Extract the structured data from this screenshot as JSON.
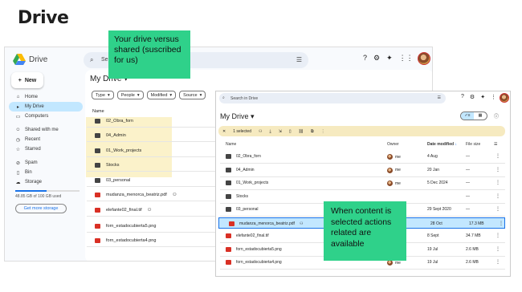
{
  "slide": {
    "title": "Drive"
  },
  "colors": {
    "accent": "#1a73e8",
    "selected": "#c2e7ff",
    "note": "#2fd18a",
    "highlight": "#fbf1c4"
  },
  "drive_left": {
    "app_name": "Drive",
    "search_placeholder": "Se",
    "new_label": "New",
    "nav": [
      {
        "label": "Home",
        "icon": "home-icon"
      },
      {
        "label": "My Drive",
        "icon": "drive-icon",
        "active": true
      },
      {
        "label": "Computers",
        "icon": "computer-icon"
      },
      {
        "label": "Shared with me",
        "icon": "people-icon"
      },
      {
        "label": "Recent",
        "icon": "clock-icon"
      },
      {
        "label": "Starred",
        "icon": "star-icon"
      },
      {
        "label": "Spam",
        "icon": "spam-icon"
      },
      {
        "label": "Bin",
        "icon": "bin-icon"
      },
      {
        "label": "Storage",
        "icon": "cloud-icon"
      }
    ],
    "storage_text": "48.85 GB of 100 GB used",
    "storage_fraction": 0.4885,
    "more_storage": "Get more storage",
    "title": "My Drive",
    "filters": [
      "Type",
      "People",
      "Modified",
      "Source"
    ],
    "column_name": "Name",
    "files": [
      {
        "name": "02_Obra_forn",
        "type": "folder"
      },
      {
        "name": "04_Admin",
        "type": "folder"
      },
      {
        "name": "01_Work_projects",
        "type": "folder"
      },
      {
        "name": "Stocks",
        "type": "shared-folder"
      },
      {
        "name": "03_personal",
        "type": "folder"
      },
      {
        "name": "mudanza_menorca_beatriz.pdf",
        "type": "pdf"
      },
      {
        "name": "elefante02_final.tif",
        "type": "image"
      },
      {
        "name": "forn_estadocubierta5.png",
        "type": "image"
      },
      {
        "name": "forn_estadocubierta4.png",
        "type": "image"
      }
    ]
  },
  "note1": {
    "text": "Your drive versus shared (suscribed for us)"
  },
  "drive_right": {
    "search_placeholder": "Search in Drive",
    "title": "My Drive",
    "selected_text": "1 selected",
    "headers": {
      "name": "Name",
      "owner": "Owner",
      "date": "Date modified",
      "size": "File size"
    },
    "rows": [
      {
        "name": "02_Obra_forn",
        "type": "folder",
        "owner": "me",
        "date": "4 Aug",
        "size": "—"
      },
      {
        "name": "04_Admin",
        "type": "folder",
        "owner": "me",
        "date": "20 Jan",
        "size": "—"
      },
      {
        "name": "01_Work_projects",
        "type": "folder",
        "owner": "me",
        "date": "5 Dec 2024",
        "size": "—"
      },
      {
        "name": "Stocks",
        "type": "shared-folder",
        "owner": "",
        "date": "",
        "size": "—"
      },
      {
        "name": "03_personal",
        "type": "folder",
        "owner": "",
        "date": "29 Sept 2020",
        "size": "—"
      },
      {
        "name": "mudanza_menorca_beatriz.pdf",
        "type": "pdf",
        "owner": "me",
        "date": "28 Oct",
        "size": "17.3 MB",
        "selected": true
      },
      {
        "name": "elefante02_final.tif",
        "type": "image",
        "owner": "me",
        "date": "8 Sept",
        "size": "34.7 MB"
      },
      {
        "name": "forn_estadocubierta5.png",
        "type": "image",
        "owner": "me",
        "date": "19 Jul",
        "size": "2.6 MB"
      },
      {
        "name": "forn_estadocubierta4.png",
        "type": "image",
        "owner": "me",
        "date": "19 Jul",
        "size": "2.6 MB"
      }
    ]
  },
  "note2": {
    "text": "When content is selected actions related are available"
  }
}
